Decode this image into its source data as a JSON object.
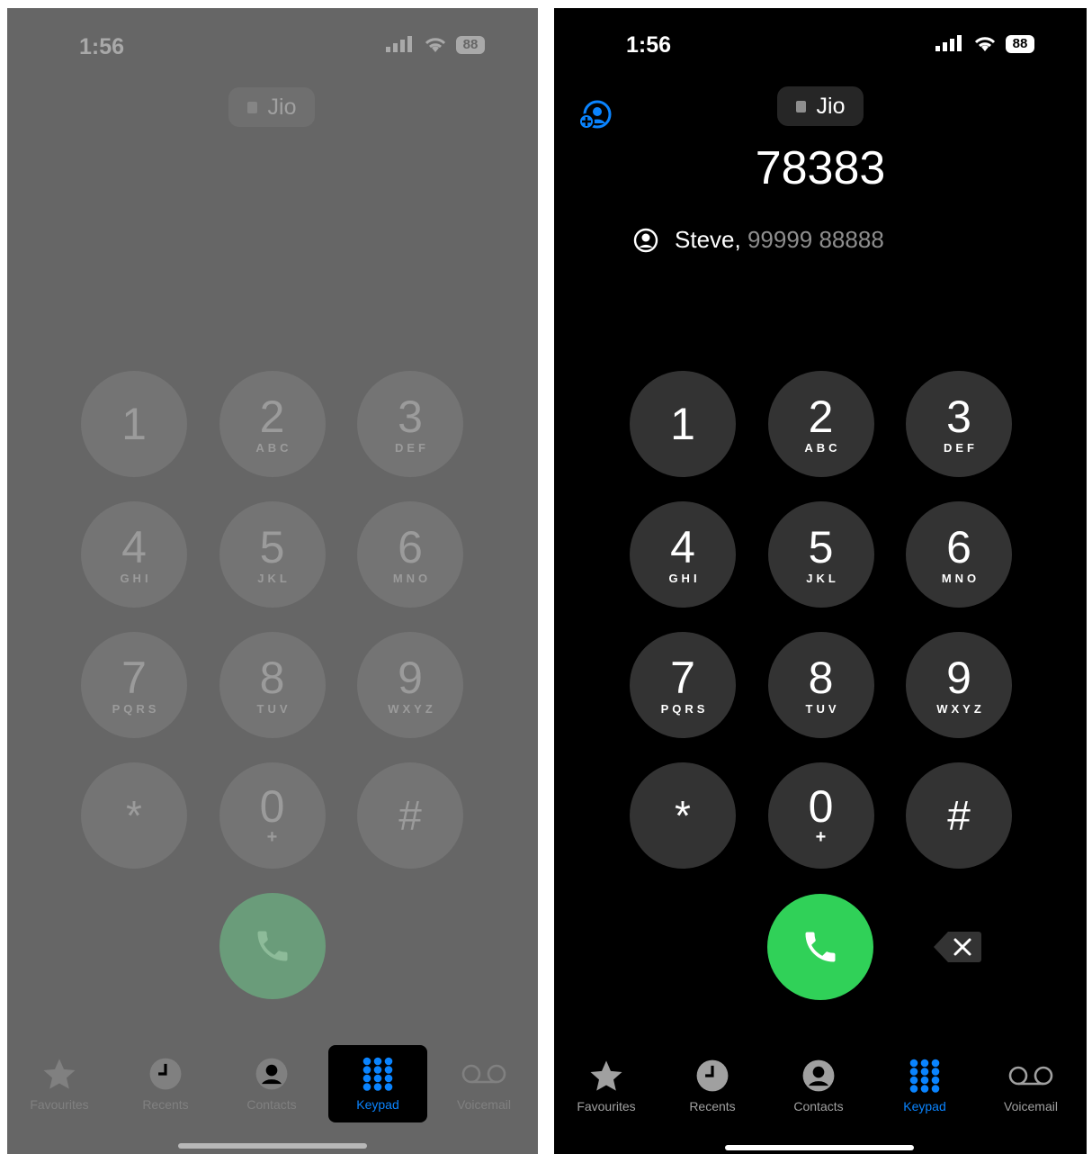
{
  "left_screen": {
    "status": {
      "time": "1:56",
      "battery": "88"
    },
    "carrier": "Jio",
    "keys": [
      {
        "digit": "1",
        "letters": ""
      },
      {
        "digit": "2",
        "letters": "ABC"
      },
      {
        "digit": "3",
        "letters": "DEF"
      },
      {
        "digit": "4",
        "letters": "GHI"
      },
      {
        "digit": "5",
        "letters": "JKL"
      },
      {
        "digit": "6",
        "letters": "MNO"
      },
      {
        "digit": "7",
        "letters": "PQRS"
      },
      {
        "digit": "8",
        "letters": "TUV"
      },
      {
        "digit": "9",
        "letters": "WXYZ"
      },
      {
        "digit": "*",
        "letters": ""
      },
      {
        "digit": "0",
        "letters": "+"
      },
      {
        "digit": "#",
        "letters": ""
      }
    ],
    "tabs": [
      {
        "label": "Favourites",
        "icon": "star-icon"
      },
      {
        "label": "Recents",
        "icon": "clock-icon"
      },
      {
        "label": "Contacts",
        "icon": "person-circle-icon"
      },
      {
        "label": "Keypad",
        "icon": "keypad-grid-icon",
        "selected": true
      },
      {
        "label": "Voicemail",
        "icon": "voicemail-icon"
      }
    ]
  },
  "right_screen": {
    "status": {
      "time": "1:56",
      "battery": "88"
    },
    "carrier": "Jio",
    "dialed_number": "78383",
    "suggestion": {
      "name": "Steve,",
      "number": "99999 88888"
    },
    "keys": [
      {
        "digit": "1",
        "letters": ""
      },
      {
        "digit": "2",
        "letters": "ABC"
      },
      {
        "digit": "3",
        "letters": "DEF"
      },
      {
        "digit": "4",
        "letters": "GHI"
      },
      {
        "digit": "5",
        "letters": "JKL"
      },
      {
        "digit": "6",
        "letters": "MNO"
      },
      {
        "digit": "7",
        "letters": "PQRS"
      },
      {
        "digit": "8",
        "letters": "TUV"
      },
      {
        "digit": "9",
        "letters": "WXYZ"
      },
      {
        "digit": "*",
        "letters": ""
      },
      {
        "digit": "0",
        "letters": "+"
      },
      {
        "digit": "#",
        "letters": ""
      }
    ],
    "tabs": [
      {
        "label": "Favourites",
        "icon": "star-icon"
      },
      {
        "label": "Recents",
        "icon": "clock-icon"
      },
      {
        "label": "Contacts",
        "icon": "person-circle-icon"
      },
      {
        "label": "Keypad",
        "icon": "keypad-grid-icon",
        "selected": true
      },
      {
        "label": "Voicemail",
        "icon": "voicemail-icon"
      }
    ]
  },
  "colors": {
    "accent_blue": "#0a84ff",
    "call_green": "#30d158",
    "key_dark": "#333333",
    "left_overlay_bg": "#666666"
  }
}
